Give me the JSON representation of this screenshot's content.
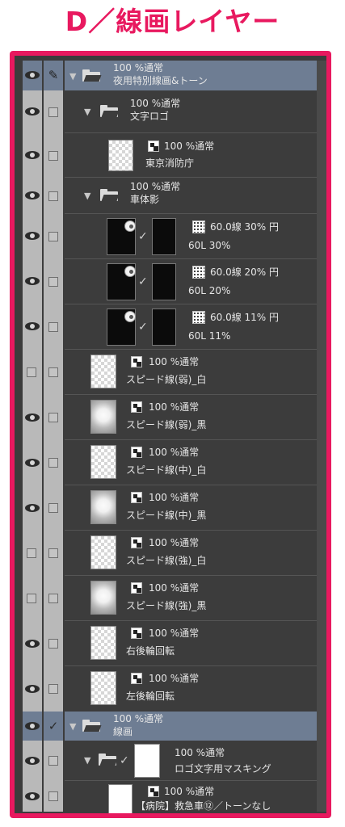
{
  "title": "D／線画レイヤー",
  "layers": [
    {
      "id": "row0",
      "type": "folder",
      "expanded": true,
      "selected": true,
      "depth": 0,
      "mode": "100 %通常",
      "name": "夜用特別線画&トーン",
      "eye": true,
      "pen": true
    },
    {
      "id": "row1",
      "type": "folder",
      "expanded": true,
      "depth": 1,
      "mode": "100 %通常",
      "name": "文字ロゴ",
      "eye": true
    },
    {
      "id": "row2",
      "type": "layer",
      "depth": 2,
      "mode": "100 %通常",
      "name": "東京消防庁",
      "eye": true,
      "thumb": "checker"
    },
    {
      "id": "row3",
      "type": "folder",
      "expanded": true,
      "depth": 1,
      "mode": "100 %通常",
      "name": "車体影",
      "eye": true
    },
    {
      "id": "row4",
      "type": "tone",
      "depth": 2,
      "mode": "60.0線 30% 円",
      "name": "60L 30%",
      "eye": true
    },
    {
      "id": "row5",
      "type": "tone",
      "depth": 2,
      "mode": "60.0線 20% 円",
      "name": "60L 20%",
      "eye": true
    },
    {
      "id": "row6",
      "type": "tone",
      "depth": 2,
      "mode": "60.0線 11% 円",
      "name": "60L 11%",
      "eye": true
    },
    {
      "id": "row7",
      "type": "layer",
      "depth": 1,
      "mode": "100 %通常",
      "name": "スピード線(弱)_白",
      "eye": false,
      "thumb": "checker"
    },
    {
      "id": "row8",
      "type": "layer",
      "depth": 1,
      "mode": "100 %通常",
      "name": "スピード線(弱)_黒",
      "eye": true,
      "thumb": "blur"
    },
    {
      "id": "row9",
      "type": "layer",
      "depth": 1,
      "mode": "100 %通常",
      "name": "スピード線(中)_白",
      "eye": true,
      "thumb": "checker"
    },
    {
      "id": "row10",
      "type": "layer",
      "depth": 1,
      "mode": "100 %通常",
      "name": "スピード線(中)_黒",
      "eye": true,
      "thumb": "blur"
    },
    {
      "id": "row11",
      "type": "layer",
      "depth": 1,
      "mode": "100 %通常",
      "name": "スピード線(強)_白",
      "eye": false,
      "thumb": "checker"
    },
    {
      "id": "row12",
      "type": "layer",
      "depth": 1,
      "mode": "100 %通常",
      "name": "スピード線(強)_黒",
      "eye": false,
      "thumb": "blur"
    },
    {
      "id": "row13",
      "type": "layer",
      "depth": 1,
      "mode": "100 %通常",
      "name": "右後輪回転",
      "eye": true,
      "thumb": "checker"
    },
    {
      "id": "row14",
      "type": "layer",
      "depth": 1,
      "mode": "100 %通常",
      "name": "左後輪回転",
      "eye": true,
      "thumb": "checker"
    },
    {
      "id": "row15",
      "type": "folder",
      "expanded": true,
      "selected": true,
      "depth": 0,
      "mode": "100 %通常",
      "name": "線画",
      "eye": true,
      "check": true
    },
    {
      "id": "row16",
      "type": "folder-mask",
      "expanded": true,
      "depth": 1,
      "mode": "100 %通常",
      "name": "ロゴ文字用マスキング",
      "eye": true
    },
    {
      "id": "row17",
      "type": "layer",
      "depth": 2,
      "mode": "100 %通常",
      "name": "【病院】救急車⑫／トーンなし",
      "eye": true,
      "thumb": "white"
    }
  ],
  "colors": {
    "accent": "#e8195f",
    "panel": "#3c3c3c",
    "selected": "#6e7d93",
    "strip": "#b9b9b9"
  }
}
